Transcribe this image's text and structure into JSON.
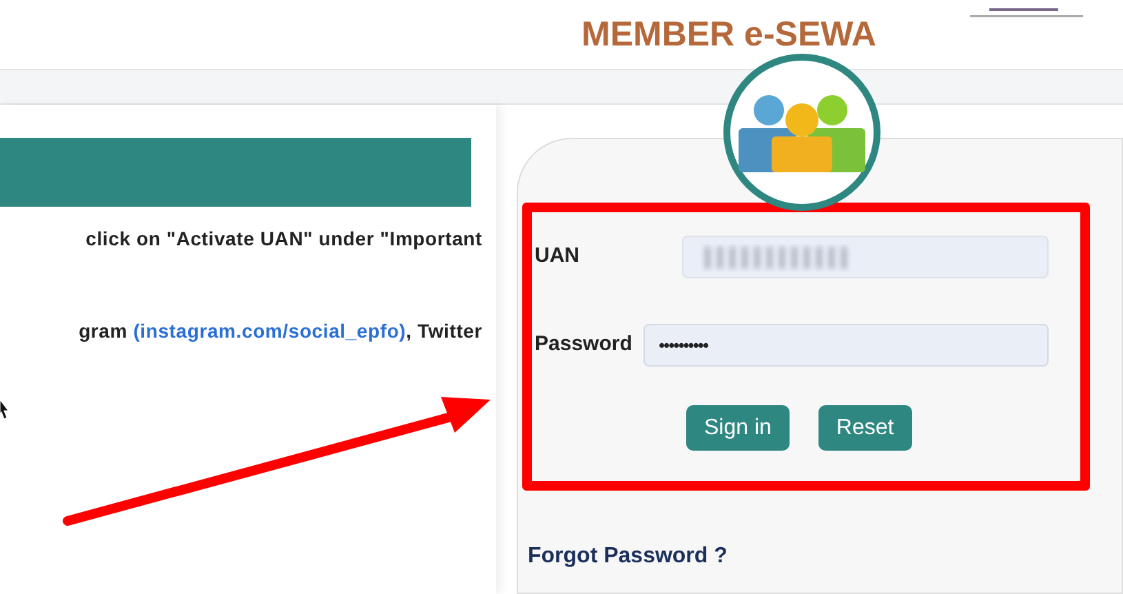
{
  "header": {
    "title": "MEMBER e-SEWA"
  },
  "notice": {
    "line": "click on \"Activate UAN\" under \"Important",
    "prefix": "gram",
    "link": "(instagram.com/social_epfo)",
    "suffix": ", Twitter"
  },
  "login": {
    "fields": [
      {
        "label": "UAN",
        "kind": "blurred"
      },
      {
        "label": "Password",
        "kind": "masked",
        "value": "••••••••••"
      }
    ],
    "buttons": [
      "Sign in",
      "Reset"
    ],
    "forgot": "Forgot Password ?"
  }
}
